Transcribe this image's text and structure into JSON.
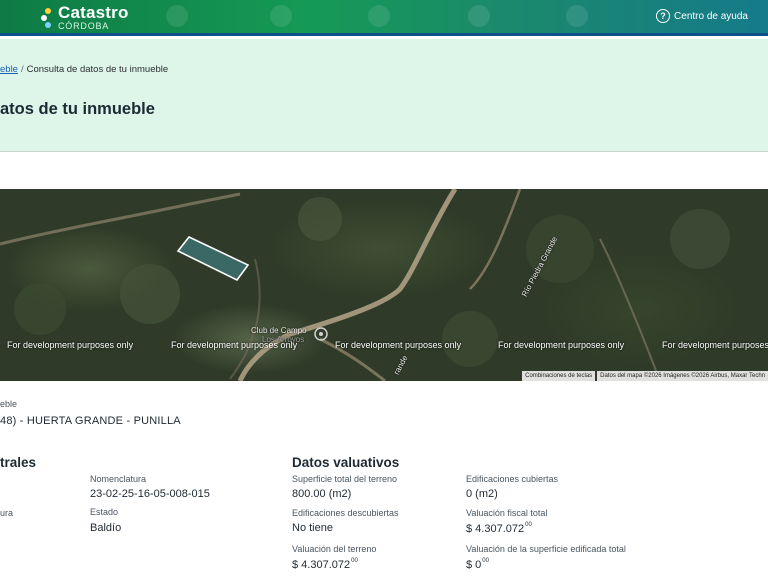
{
  "header": {
    "brand_title": "Catastro",
    "brand_subtitle": "CÓRDOBA",
    "help_label": "Centro de ayuda",
    "help_icon": "question-circle-icon"
  },
  "breadcrumb": {
    "parent_label": "eble",
    "current_label": "Consulta de datos de tu inmueble"
  },
  "page_title": "atos de tu inmueble",
  "map": {
    "watermark": "For development purposes only",
    "labels": {
      "club": "Club de Campo",
      "club_sub": "Los Arroyos",
      "river": "Río Piedra Grande",
      "road": "rande"
    },
    "attribution": {
      "shortcuts": "Combinaciones de teclas",
      "data": "Datos del mapa ©2026 Imágenes ©2026 Airbus, Maxar Techn"
    }
  },
  "location": {
    "label": "eble",
    "value": "48) - HUERTA GRANDE - PUNILLA"
  },
  "cadastral": {
    "title": "trales",
    "nomenclatura_label": "Nomenclatura",
    "nomenclatura_value": "23-02-25-16-05-008-015",
    "left_fragment_label": "ura",
    "estado_label": "Estado",
    "estado_value": "Baldío"
  },
  "valuation": {
    "title": "Datos valuativos",
    "superficie_terreno_label": "Superficie total del terreno",
    "superficie_terreno_value": "800.00 (m2)",
    "edif_cubiertas_label": "Edificaciones cubiertas",
    "edif_cubiertas_value": "0 (m2)",
    "edif_descubiertas_label": "Edificaciones descubiertas",
    "edif_descubiertas_value": "No tiene",
    "valuacion_fiscal_label": "Valuación fiscal total",
    "valuacion_fiscal_value": "$ 4.307.072",
    "valuacion_fiscal_cents": "00",
    "valuacion_terreno_label": "Valuación del terreno",
    "valuacion_terreno_value": "$ 4.307.072",
    "valuacion_terreno_cents": "00",
    "valuacion_edificada_label": "Valuación de la superficie edificada total",
    "valuacion_edificada_value": "$ 0",
    "valuacion_edificada_cents": "00"
  },
  "colors": {
    "header_green": "#159a55",
    "header_border": "#10508a",
    "banner_bg": "#def5ea",
    "link": "#1a5fb4",
    "parcel_outline": "#ffffff"
  }
}
